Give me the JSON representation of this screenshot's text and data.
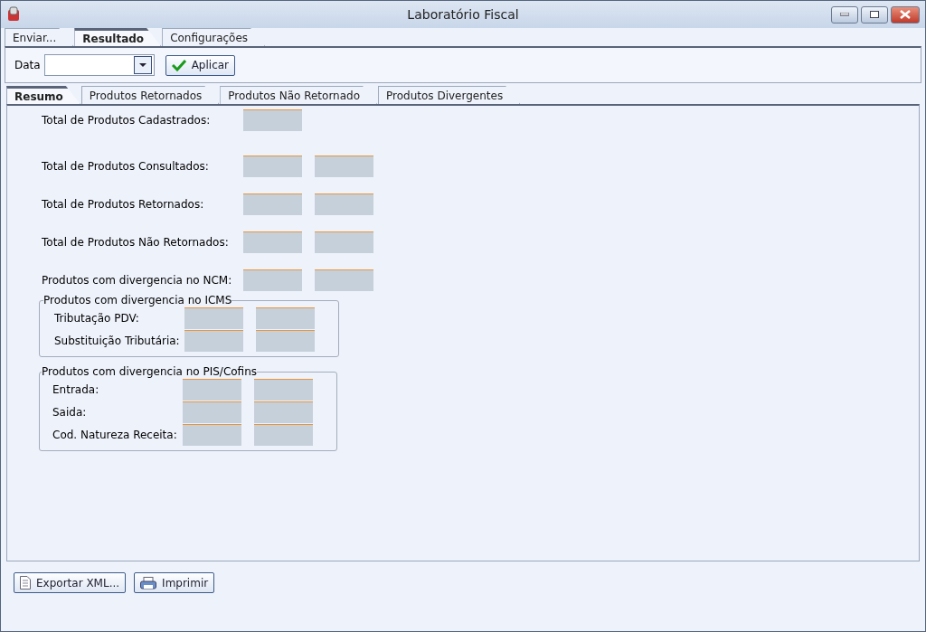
{
  "window": {
    "title": "Laboratório Fiscal"
  },
  "tabs": [
    {
      "label": "Enviar...",
      "selected": false
    },
    {
      "label": "Resultado",
      "selected": true
    },
    {
      "label": "Configurações",
      "selected": false
    }
  ],
  "filter": {
    "label": "Data",
    "button": "Aplicar"
  },
  "subtabs": [
    {
      "label": "Resumo",
      "selected": true
    },
    {
      "label": "Produtos Retornados",
      "selected": false
    },
    {
      "label": "Produtos Não Retornado",
      "selected": false
    },
    {
      "label": "Produtos Divergentes",
      "selected": false
    }
  ],
  "totals": [
    {
      "label": "Total de Produtos Cadastrados:",
      "kind": "single"
    },
    {
      "label": "Total de Produtos Consultados:",
      "kind": "pair"
    },
    {
      "label": "Total de Produtos Retornados:",
      "kind": "pair"
    },
    {
      "label": "Total de Produtos Não Retornados:",
      "kind": "pair"
    },
    {
      "label": "Produtos com divergencia no NCM:",
      "kind": "pair"
    }
  ],
  "groups": [
    {
      "title": "Produtos com divergencia no ICMS",
      "rows": [
        {
          "label": "Tributação PDV:",
          "kind": "pair"
        },
        {
          "label": "Substituição Tributária:",
          "kind": "pair"
        }
      ]
    },
    {
      "title": "Produtos com divergencia no PIS/Cofins",
      "rows": [
        {
          "label": "Entrada:",
          "kind": "pair"
        },
        {
          "label": "Saida:",
          "kind": "pair"
        },
        {
          "label": "Cod. Natureza Receita:",
          "kind": "pair"
        }
      ]
    }
  ],
  "buttons": [
    {
      "label": "Exportar XML...",
      "kind": "document"
    },
    {
      "label": "Imprimir",
      "kind": "printer"
    }
  ]
}
